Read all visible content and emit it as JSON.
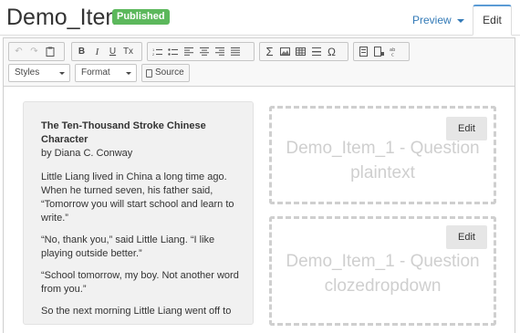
{
  "header": {
    "title": "Demo_Item",
    "status_badge": "Published",
    "tabs": [
      {
        "label": "Preview",
        "has_dropdown": true,
        "active": false
      },
      {
        "label": "Edit",
        "active": true
      }
    ]
  },
  "toolbar": {
    "row1_icons": [
      [
        "undo-icon",
        "redo-icon",
        "paste-text-icon"
      ],
      [
        "bold-icon",
        "italic-icon",
        "underline-icon",
        "remove-format-icon"
      ],
      [
        "numbered-list-icon",
        "bulleted-list-icon",
        "align-left-icon",
        "align-center-icon",
        "align-right-icon",
        "justify-icon"
      ],
      [
        "sigma-icon",
        "image-icon",
        "table-icon",
        "horizontal-rule-icon",
        "omega-special-char-icon"
      ],
      [
        "template-icon",
        "response-box-icon",
        "abc-icon"
      ]
    ],
    "glyphs": {
      "bold": "B",
      "italic": "I",
      "underline": "U",
      "remove_format": "Tx",
      "sigma": "Σ",
      "omega": "Ω",
      "undo": "↶",
      "redo": "↷"
    },
    "styles_label": "Styles",
    "format_label": "Format",
    "source_label": "Source"
  },
  "passage": {
    "title": "The Ten-Thousand Stroke Chinese Character",
    "byline": "by Diana C. Conway",
    "paragraphs": [
      "Little Liang lived in China a long time ago. When he turned seven, his father said, “Tomorrow you will start school and learn to write.”",
      "“No, thank you,” said Little Liang. “I like playing outside better.”",
      "“School tomorrow, my boy. Not another word from you.”",
      "So the next morning Little Liang went off to"
    ]
  },
  "questions": [
    {
      "label": "Demo_Item_1 - Question plaintext",
      "edit_label": "Edit"
    },
    {
      "label": "Demo_Item_1 - Question clozedropdown",
      "edit_label": "Edit"
    }
  ]
}
